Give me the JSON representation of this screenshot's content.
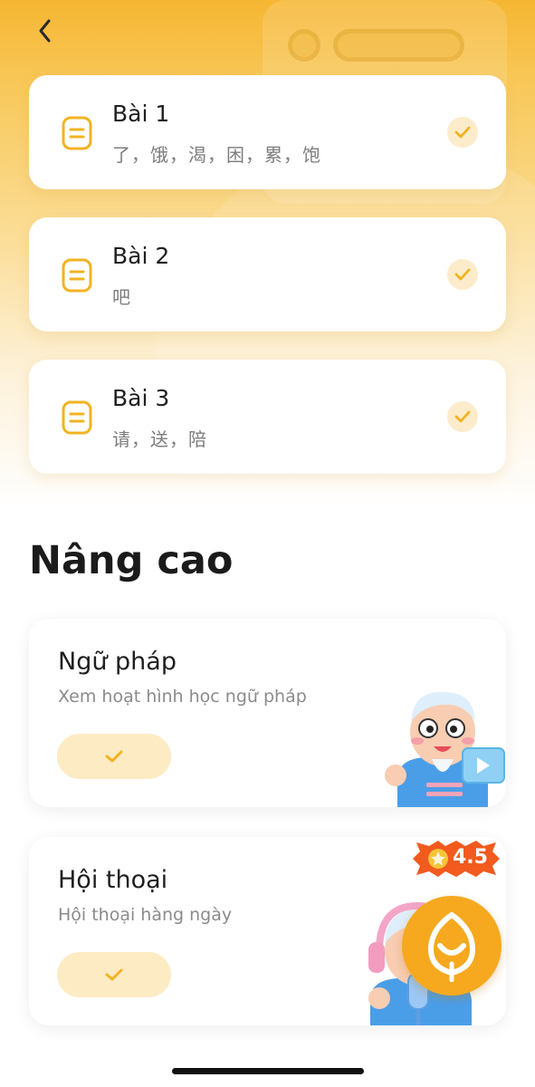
{
  "header": {
    "back_icon": "chevron-left-icon"
  },
  "lessons": [
    {
      "title": "Bài 1",
      "subtitle": "了，饿，渴，困，累，饱",
      "icon": "lesson-doc-icon",
      "status": "completed"
    },
    {
      "title": "Bài 2",
      "subtitle": "吧",
      "icon": "lesson-doc-icon",
      "status": "completed"
    },
    {
      "title": "Bài 3",
      "subtitle": "请，送，陪",
      "icon": "lesson-doc-icon",
      "status": "completed"
    }
  ],
  "advanced": {
    "section_title": "Nâng cao",
    "cards": [
      {
        "title": "Ngữ pháp",
        "subtitle": "Xem hoạt hình học ngữ pháp",
        "button_icon": "check-icon",
        "mascot": "grandpa-video-mascot"
      },
      {
        "title": "Hội thoại",
        "subtitle": "Hội thoại hàng ngày",
        "button_icon": "check-icon",
        "mascot": "grandpa-headphones-mascot"
      }
    ]
  },
  "rating_badge": {
    "value": "4.5",
    "icon": "star-icon"
  },
  "fab": {
    "icon": "app-logo-icon"
  },
  "colors": {
    "accent": "#f6a91f",
    "check_bg": "#fdeccb",
    "icon_yellow": "#f2b321"
  }
}
